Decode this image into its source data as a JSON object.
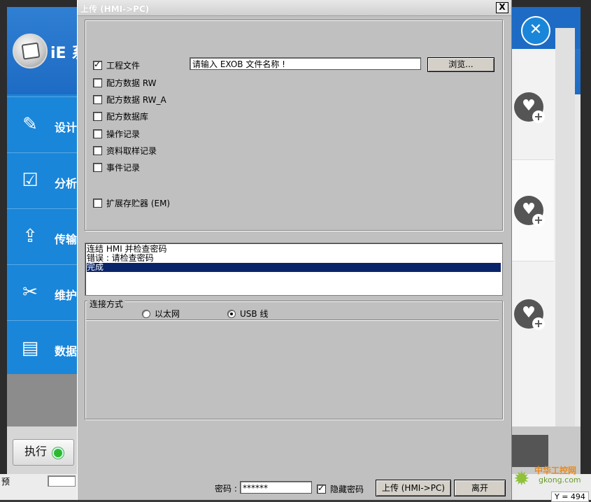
{
  "background": {
    "brand": "iE 系",
    "nav": [
      {
        "label": "设计",
        "icon": "design-icon"
      },
      {
        "label": "分析",
        "icon": "analysis-icon"
      },
      {
        "label": "传输",
        "icon": "transfer-icon"
      },
      {
        "label": "维护",
        "icon": "maintenance-icon"
      },
      {
        "label": "数据",
        "icon": "data-icon"
      }
    ],
    "run_label": "执行",
    "status_text": "预",
    "status_y": "Y = 494",
    "watermark_line1": "中华工控网",
    "watermark_line2": "gkong.com"
  },
  "dialog": {
    "title": "上传 (HMI->PC)",
    "close_glyph": "X",
    "options": [
      {
        "label": "工程文件",
        "checked": true
      },
      {
        "label": "配方数据 RW",
        "checked": false
      },
      {
        "label": "配方数据 RW_A",
        "checked": false
      },
      {
        "label": "配方数据库",
        "checked": false
      },
      {
        "label": "操作记录",
        "checked": false
      },
      {
        "label": "资料取样记录",
        "checked": false
      },
      {
        "label": "事件记录",
        "checked": false
      }
    ],
    "extended": {
      "label": "扩展存贮器 (EM)",
      "checked": false
    },
    "file_input_value": "请输入 EXOB 文件名称 !",
    "browse_label": "浏览...",
    "log": [
      "连结 HMI 并检查密码",
      "错误 : 请检查密码",
      "完成"
    ],
    "connection": {
      "legend": "连接方式",
      "ethernet_label": "以太网",
      "usb_label": "USB 线",
      "selected": "usb"
    },
    "password_label": "密码 :",
    "password_value": "******",
    "hide_password_label": "隐藏密码",
    "hide_password_checked": true,
    "upload_label": "上传 (HMI->PC)",
    "leave_label": "离开"
  }
}
